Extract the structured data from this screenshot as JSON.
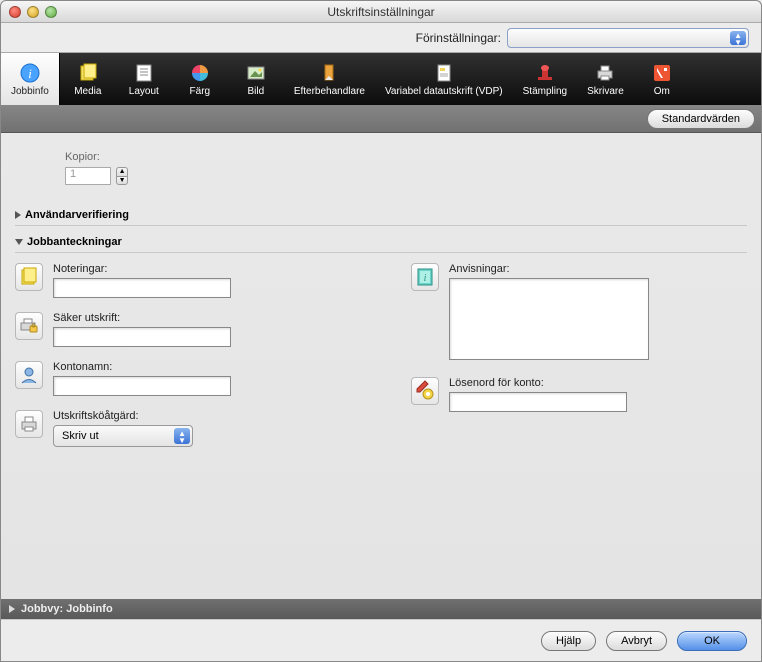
{
  "title": "Utskriftsinställningar",
  "presets": {
    "label": "Förinställningar:",
    "selected": ""
  },
  "tabs": [
    {
      "label": "Jobbinfo"
    },
    {
      "label": "Media"
    },
    {
      "label": "Layout"
    },
    {
      "label": "Färg"
    },
    {
      "label": "Bild"
    },
    {
      "label": "Efterbehandlare"
    },
    {
      "label": "Variabel datautskrift (VDP)"
    },
    {
      "label": "Stämpling"
    },
    {
      "label": "Skrivare"
    },
    {
      "label": "Om"
    }
  ],
  "defaults_button": "Standardvärden",
  "copies": {
    "label": "Kopior:",
    "value": "1"
  },
  "sections": {
    "user_verify": "Användarverifiering",
    "job_notes": "Jobbanteckningar"
  },
  "fields": {
    "notes": {
      "label": "Noteringar:"
    },
    "secure": {
      "label": "Säker utskrift:"
    },
    "account": {
      "label": "Kontonamn:"
    },
    "queue_action": {
      "label": "Utskriftsköåtgärd:",
      "value": "Skriv ut"
    },
    "instructions": {
      "label": "Anvisningar:"
    },
    "account_pw": {
      "label": "Lösenord för konto:"
    }
  },
  "statusbar": "Jobbvy: Jobbinfo",
  "buttons": {
    "help": "Hjälp",
    "cancel": "Avbryt",
    "ok": "OK"
  }
}
